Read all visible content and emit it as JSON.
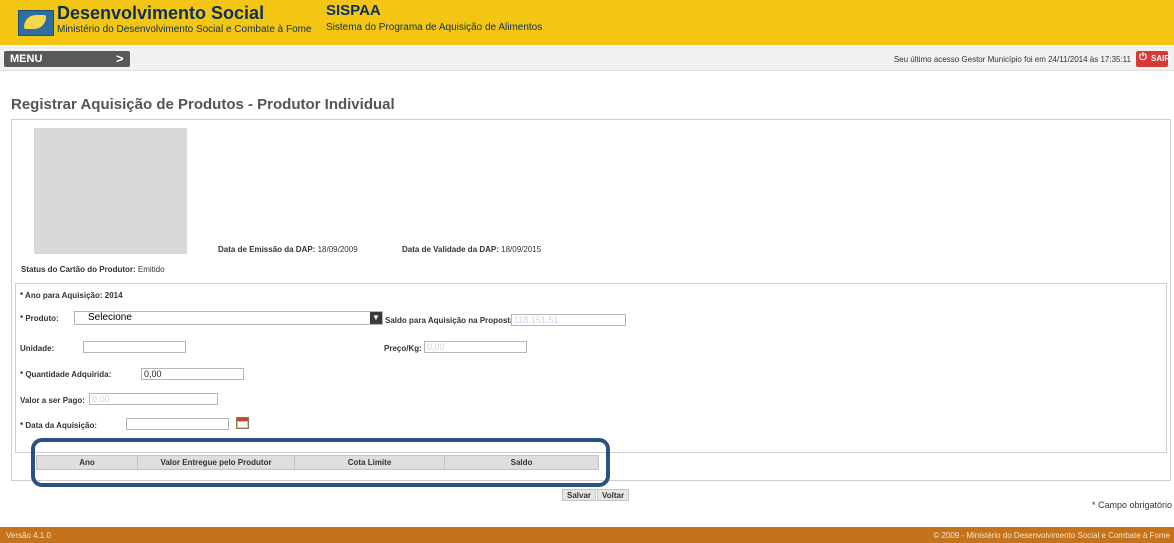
{
  "header": {
    "brand_title": "Desenvolvimento Social",
    "brand_subtitle": "Ministério do Desenvolvimento Social e Combate à Fome",
    "system_title": "SISPAA",
    "system_subtitle": "Sistema do Programa de Aquisição de Alimentos"
  },
  "menubar": {
    "menu_label": "MENU",
    "menu_arrow": ">",
    "last_access": "Seu último acesso Gestor Município foi em 24/11/2014 às 17:35:11",
    "logout_label": "SAIR"
  },
  "page": {
    "title": "Registrar Aquisição de Produtos - Produtor Individual"
  },
  "card": {
    "status_label": "Status do Cartão do Produtor:",
    "status_value": "Emitido",
    "dap_emission_label": "Data de Emissão da DAP:",
    "dap_emission_value": "18/09/2009",
    "dap_validity_label": "Data de Validade da DAP:",
    "dap_validity_value": "18/09/2015"
  },
  "form": {
    "year_label": "* Ano para Aquisição:",
    "year_value": "2014",
    "product_label": "* Produto:",
    "product_selected": "Selecione",
    "balance_label": "Saldo para Aquisição na Proposta:",
    "balance_value": "118.151,51",
    "unit_label": "Unidade:",
    "unit_value": "",
    "price_label": "Preço/Kg:",
    "price_value": "0,00",
    "quantity_label": "* Quantidade Adquirida:",
    "quantity_value": "0,00",
    "amount_label": "Valor a ser Pago:",
    "amount_value": "0,00",
    "date_label": "* Data da Aquisição:",
    "date_value": ""
  },
  "table": {
    "columns": [
      "Ano",
      "Valor Entregue pelo Produtor",
      "Cota Limite",
      "Saldo"
    ]
  },
  "actions": {
    "save_label": "Salvar",
    "back_label": "Voltar",
    "required_note": "* Campo obrigatório"
  },
  "footer": {
    "version": "Versão 4.1.0",
    "copyright": "© 2009 - Ministério do Desenvolvimento Social e Combate à Fome"
  },
  "colors": {
    "header_bg": "#f3c614",
    "footer_bg": "#c4731b",
    "highlight_border": "#2b5183",
    "logout_bg": "#d43a36"
  }
}
